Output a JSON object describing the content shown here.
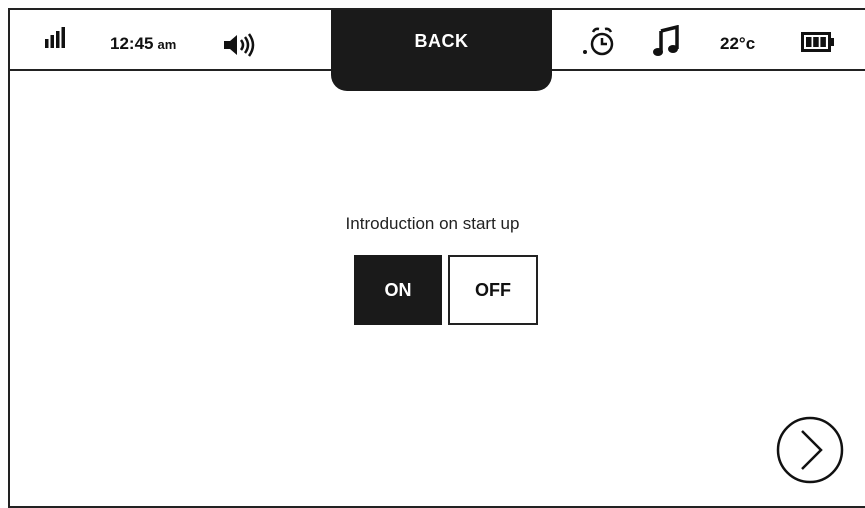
{
  "status_bar": {
    "time": "12:45",
    "ampm": "am",
    "temperature": "22°c",
    "icons": [
      "signal-icon",
      "speaker-icon",
      "alarm-icon",
      "music-icon",
      "battery-icon"
    ]
  },
  "back_button": {
    "label": "BACK"
  },
  "setting": {
    "label": "Introduction on start up",
    "on_label": "ON",
    "off_label": "OFF",
    "selected": "ON"
  },
  "next_button": {
    "icon": "chevron-right-circle-icon"
  }
}
